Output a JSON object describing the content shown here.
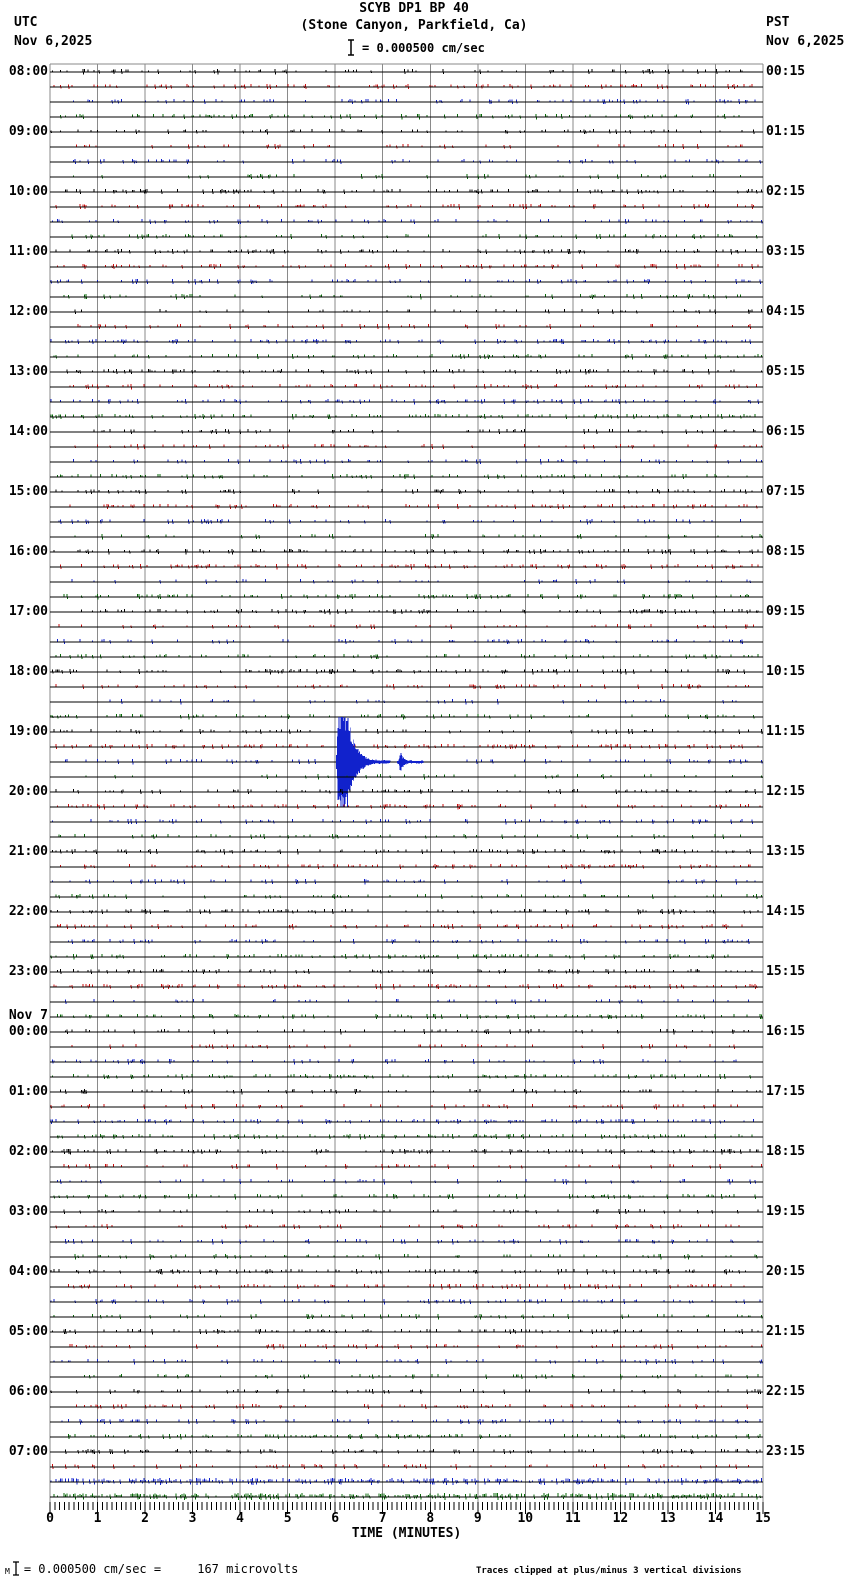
{
  "header": {
    "title": "SCYB DP1 BP 40",
    "subtitle": "(Stone Canyon, Parkfield, Ca)",
    "scale_label": "= 0.000500 cm/sec",
    "left_tz": "UTC",
    "left_date": "Nov 6,2025",
    "right_tz": "PST",
    "right_date": "Nov 6,2025"
  },
  "left_axis": {
    "hours": [
      "08:00",
      "09:00",
      "10:00",
      "11:00",
      "12:00",
      "13:00",
      "14:00",
      "15:00",
      "16:00",
      "17:00",
      "18:00",
      "19:00",
      "20:00",
      "21:00",
      "22:00",
      "23:00",
      "00:00",
      "01:00",
      "02:00",
      "03:00",
      "04:00",
      "05:00",
      "06:00",
      "07:00"
    ],
    "day_break_index": 16,
    "day_break_label": "Nov 7"
  },
  "right_axis": {
    "hours": [
      "00:15",
      "01:15",
      "02:15",
      "03:15",
      "04:15",
      "05:15",
      "06:15",
      "07:15",
      "08:15",
      "09:15",
      "10:15",
      "11:15",
      "12:15",
      "13:15",
      "14:15",
      "15:15",
      "16:15",
      "17:15",
      "18:15",
      "19:15",
      "20:15",
      "21:15",
      "22:15",
      "23:15"
    ]
  },
  "x_axis": {
    "label": "TIME (MINUTES)",
    "ticks": [
      "0",
      "1",
      "2",
      "3",
      "4",
      "5",
      "6",
      "7",
      "8",
      "9",
      "10",
      "11",
      "12",
      "13",
      "14",
      "15"
    ]
  },
  "footer": {
    "scale_note_prefix": "M",
    "scale_note": "= 0.000500 cm/sec =     167 microvolts",
    "clip_note": "Traces clipped at plus/minus 3 vertical divisions"
  },
  "chart_data": {
    "type": "line",
    "variant": "helicorder-seismogram",
    "title": "SCYB DP1 BP 40",
    "subtitle": "(Stone Canyon, Parkfield, Ca)",
    "xlabel": "TIME (MINUTES)",
    "xlim": [
      0,
      15
    ],
    "x_ticks": [
      0,
      1,
      2,
      3,
      4,
      5,
      6,
      7,
      8,
      9,
      10,
      11,
      12,
      13,
      14,
      15
    ],
    "minor_ticks_per_minute": 10,
    "minutes_per_line": 15,
    "lines_per_hour": 4,
    "hours_shown": 24,
    "start_label_utc": "Nov 6,2025 08:00",
    "end_label_utc": "Nov 7 08:00",
    "pst_offset_hours": -8,
    "scale_cm_per_sec_per_division": 0.0005,
    "microvolts_equivalent": 167,
    "clip_divisions": 3,
    "trace_color_cycle": [
      "#000000",
      "#cc1111",
      "#1122cc",
      "#0a6a0a"
    ],
    "grid_color": "#8a8a8a",
    "noise_seed": 20251106,
    "events": [
      {
        "description": "local earthquake, clipped",
        "trace_utc": "19:30",
        "row_index": 46,
        "color": "#1122cc",
        "onset_minute": 6.02,
        "peak_minute": 6.07,
        "clip_end_minute": 6.25,
        "clipped": true,
        "coda_end_minute": 7.15,
        "aftershock": {
          "minute": 7.37,
          "amplitude_divisions": 0.6,
          "end_minute": 7.85
        }
      }
    ]
  }
}
